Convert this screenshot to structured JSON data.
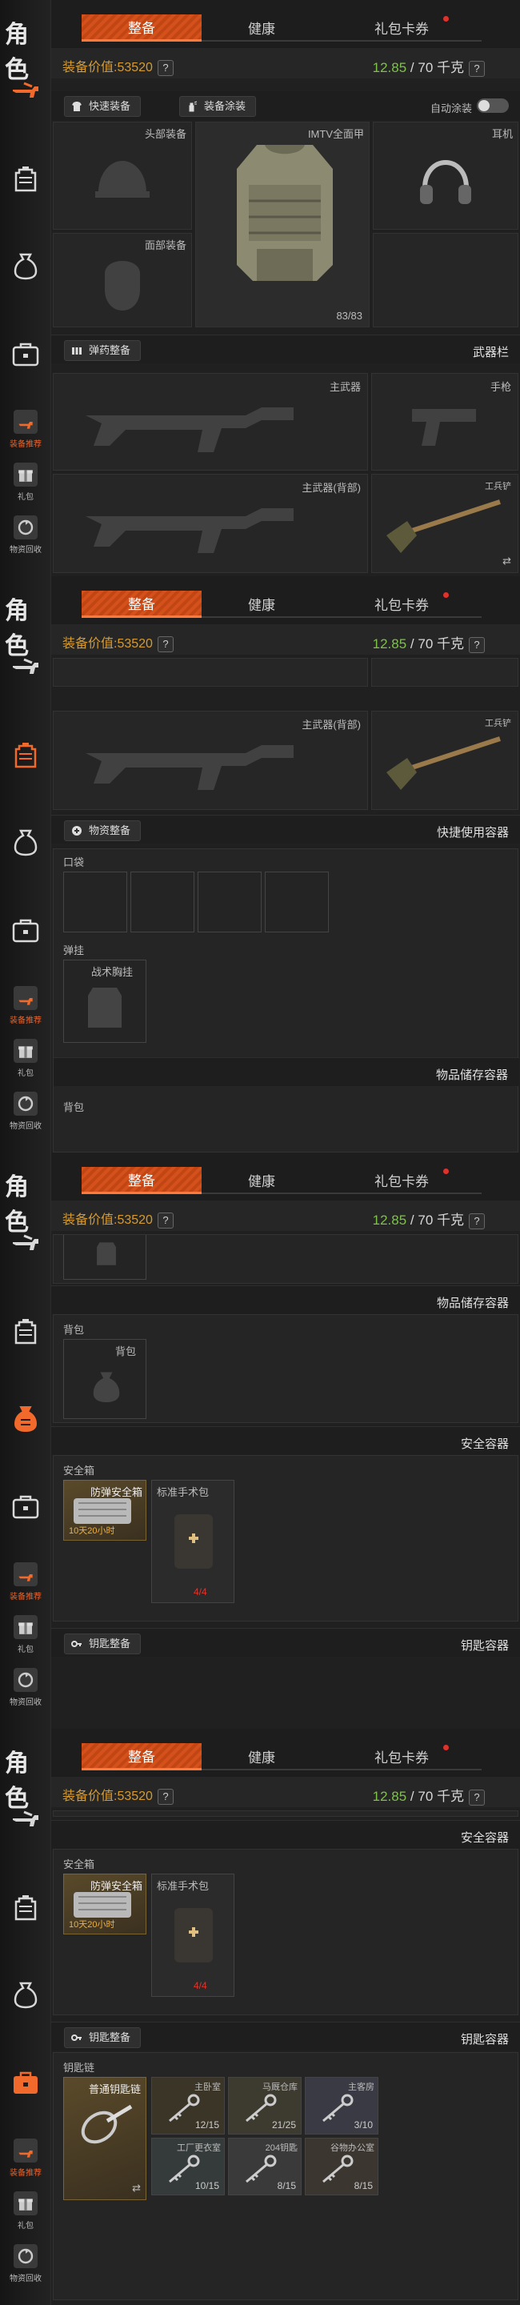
{
  "sidebar": {
    "title": "角色",
    "items": [
      {
        "label": "装备推荐"
      },
      {
        "label": "礼包"
      },
      {
        "label": "物资回收"
      }
    ]
  },
  "tabs": [
    {
      "label": "整备"
    },
    {
      "label": "健康"
    },
    {
      "label": "礼包卡券"
    }
  ],
  "summary": {
    "value_label": "装备价值:53520",
    "help": "?",
    "weight_current": "12.85",
    "weight_sep": " / ",
    "weight_max": "70 千克"
  },
  "screen1": {
    "quick_equip": "快速装备",
    "paint": "装备涂装",
    "auto_paint": "自动涂装",
    "helmet": "头部装备",
    "armor": "IMTV全面甲",
    "armor_durability": "83/83",
    "earpiece": "耳机",
    "face": "面部装备",
    "ammo_btn": "弹药整备",
    "weapon_bar": "武器栏",
    "primary": "主武器",
    "pistol": "手枪",
    "primary_back": "主武器(背部)",
    "shovel": "工兵铲",
    "swap": "⇄"
  },
  "screen2": {
    "primary_back": "主武器(背部)",
    "shovel": "工兵铲",
    "supply_btn": "物资整备",
    "quick_container": "快捷使用容器",
    "pocket": "口袋",
    "vest_section": "弹挂",
    "vest_item": "战术胸挂",
    "storage": "物品储存容器",
    "backpack": "背包"
  },
  "screen3": {
    "storage": "物品储存容器",
    "backpack_section": "背包",
    "backpack_item": "背包",
    "safe_section": "安全容器",
    "safe_box_label": "安全箱",
    "safe_box_item": "防弹安全箱",
    "safe_timer": "10天20小时",
    "medkit": "标准手术包",
    "medkit_count": "4/4",
    "key_btn": "钥匙整备",
    "key_section": "钥匙容器"
  },
  "screen4": {
    "safe_section": "安全容器",
    "safe_box_label": "安全箱",
    "safe_box_item": "防弹安全箱",
    "safe_timer": "10天20小时",
    "medkit": "标准手术包",
    "medkit_count": "4/4",
    "key_btn": "钥匙整备",
    "key_section": "钥匙容器",
    "keychain": "钥匙链",
    "keychain_item": "普通钥匙链",
    "swap": "⇄",
    "keys": [
      {
        "name": "主卧室",
        "count": "12/15"
      },
      {
        "name": "马厩仓库",
        "count": "21/25"
      },
      {
        "name": "主客房",
        "count": "3/10"
      },
      {
        "name": "工厂更衣室",
        "count": "10/15"
      },
      {
        "name": "204钥匙",
        "count": "8/15"
      },
      {
        "name": "谷物办公室",
        "count": "8/15"
      }
    ]
  },
  "colors": {
    "accent": "#e8642c",
    "value": "#d69a2e",
    "weight_ok": "#7ec24a",
    "danger": "#e0342c"
  }
}
